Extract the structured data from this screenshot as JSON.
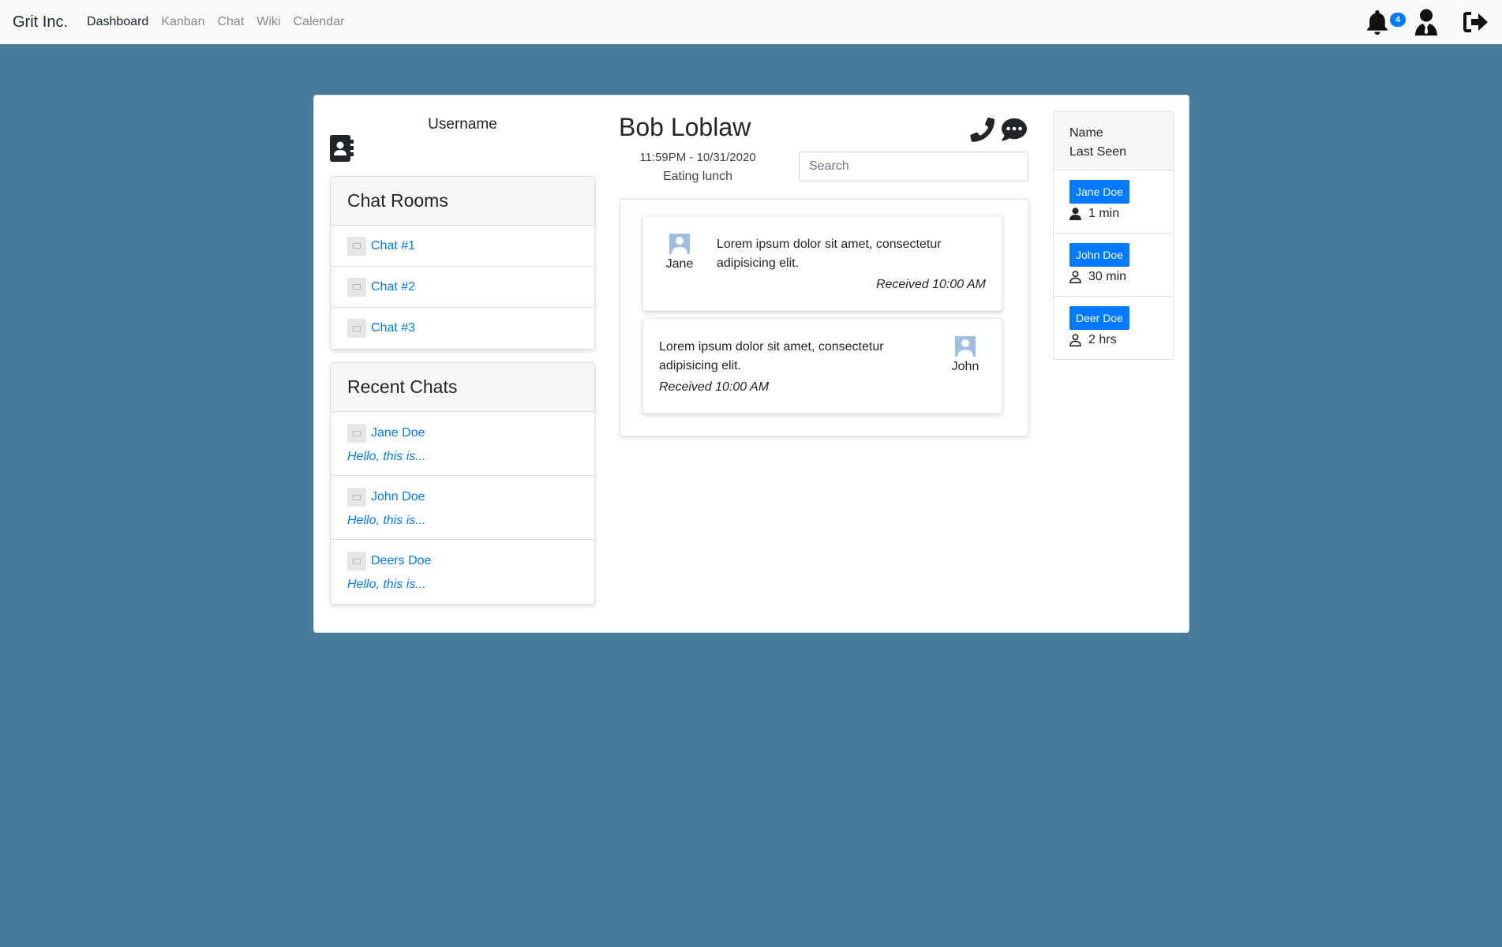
{
  "navbar": {
    "brand": "Grit Inc.",
    "links": [
      {
        "label": "Dashboard",
        "active": true
      },
      {
        "label": "Kanban",
        "active": false
      },
      {
        "label": "Chat",
        "active": false
      },
      {
        "label": "Wiki",
        "active": false
      },
      {
        "label": "Calendar",
        "active": false
      }
    ],
    "icons": {
      "notifications": "bell-icon",
      "profile": "user-tie-icon",
      "logout": "sign-out-icon"
    },
    "notification_count": "4"
  },
  "sidebar": {
    "username": "Username",
    "contacts_icon": "address-book-icon",
    "chat_rooms": {
      "title": "Chat Rooms",
      "items": [
        {
          "label": "Chat #1"
        },
        {
          "label": "Chat #2"
        },
        {
          "label": "Chat #3"
        }
      ]
    },
    "recent_chats": {
      "title": "Recent Chats",
      "items": [
        {
          "name": "Jane Doe",
          "preview": "Hello, this is..."
        },
        {
          "name": "John Doe",
          "preview": "Hello, this is..."
        },
        {
          "name": "Deers Doe",
          "preview": "Hello, this is..."
        }
      ]
    }
  },
  "conversation": {
    "contact_name": "Bob Loblaw",
    "timestamp": "11:59PM - 10/31/2020",
    "status": "Eating lunch",
    "icons": {
      "call": "phone-icon",
      "message": "comment-dots-icon"
    },
    "search_placeholder": "Search",
    "messages": [
      {
        "sender": "Jane",
        "text": "Lorem ipsum dolor sit amet, consectetur adipisicing elit.",
        "meta": "Received 10:00 AM"
      },
      {
        "sender": "John",
        "text": "Lorem ipsum dolor sit amet, consectetur adipisicing elit.",
        "meta": "Received 10:00 AM"
      }
    ]
  },
  "online_users": {
    "header_name": "Name",
    "header_last_seen": "Last Seen",
    "users": [
      {
        "name": "Jane Doe",
        "last_seen": "1 min",
        "status_icon": "user-solid-icon"
      },
      {
        "name": "John Doe",
        "last_seen": "30 min",
        "status_icon": "user-outline-icon"
      },
      {
        "name": "Deer Doe",
        "last_seen": "2 hrs",
        "status_icon": "user-outline-icon"
      }
    ]
  },
  "colors": {
    "background": "#467b9c",
    "accent": "#007bff",
    "navbar": "#f8f9fa"
  }
}
